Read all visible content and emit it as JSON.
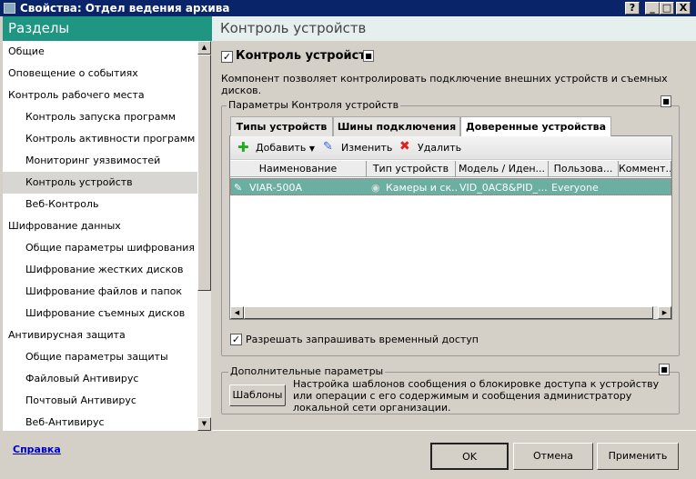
{
  "window": {
    "title": "Свойства: Отдел ведения архива",
    "help_btn": "?",
    "min_btn": "_",
    "max_btn": "□",
    "close_btn": "X"
  },
  "sidebar": {
    "title": "Разделы",
    "items": [
      {
        "label": "Общие",
        "level": 0
      },
      {
        "label": "Оповещение о событиях",
        "level": 0
      },
      {
        "label": "Контроль рабочего места",
        "level": 0
      },
      {
        "label": "Контроль запуска программ",
        "level": 1
      },
      {
        "label": "Контроль активности программ",
        "level": 1
      },
      {
        "label": "Мониторинг уязвимостей",
        "level": 1
      },
      {
        "label": "Контроль устройств",
        "level": 1,
        "selected": true
      },
      {
        "label": "Веб-Контроль",
        "level": 1
      },
      {
        "label": "Шифрование данных",
        "level": 0
      },
      {
        "label": "Общие параметры шифрования",
        "level": 1
      },
      {
        "label": "Шифрование жестких дисков",
        "level": 1
      },
      {
        "label": "Шифрование файлов и папок",
        "level": 1
      },
      {
        "label": "Шифрование съемных дисков",
        "level": 1
      },
      {
        "label": "Антивирусная защита",
        "level": 0
      },
      {
        "label": "Общие параметры защиты",
        "level": 1
      },
      {
        "label": "Файловый Антивирус",
        "level": 1
      },
      {
        "label": "Почтовый Антивирус",
        "level": 1
      },
      {
        "label": "Веб-Антивирус",
        "level": 1
      }
    ],
    "help_link": "Справка"
  },
  "main": {
    "title": "Контроль устройств",
    "enable_label": "Контроль устройств",
    "enable_checked": true,
    "description": "Компонент позволяет контролировать подключение внешних устройств и съемных дисков.",
    "params_group": "Параметры Контроля устройств",
    "tabs": [
      "Типы устройств",
      "Шины подключения",
      "Доверенные устройства"
    ],
    "active_tab": 2,
    "toolbar": {
      "add": "Добавить",
      "edit": "Изменить",
      "delete": "Удалить"
    },
    "columns": [
      "Наименование",
      "Тип устройств",
      "Модель / Иден...",
      "Пользова...",
      "Коммент..."
    ],
    "rows": [
      {
        "name": "VIAR-500A",
        "type": "Камеры и ск...",
        "model": "VID_0AC8&PID_...",
        "user": "Everyone",
        "comment": ""
      }
    ],
    "temp_access_label": "Разрешать запрашивать временный доступ",
    "temp_access_checked": true,
    "extra_group": "Дополнительные параметры",
    "templates_btn": "Шаблоны",
    "templates_desc": "Настройка шаблонов сообщения о блокировке доступа к устройству или операции с его содержимым и сообщения администратору локальной сети организации."
  },
  "buttons": {
    "ok": "OK",
    "cancel": "Отмена",
    "apply": "Применить"
  },
  "colors": {
    "titlebar": "#0a246a",
    "accent": "#1f9682",
    "selected_row": "#6aafa2"
  }
}
